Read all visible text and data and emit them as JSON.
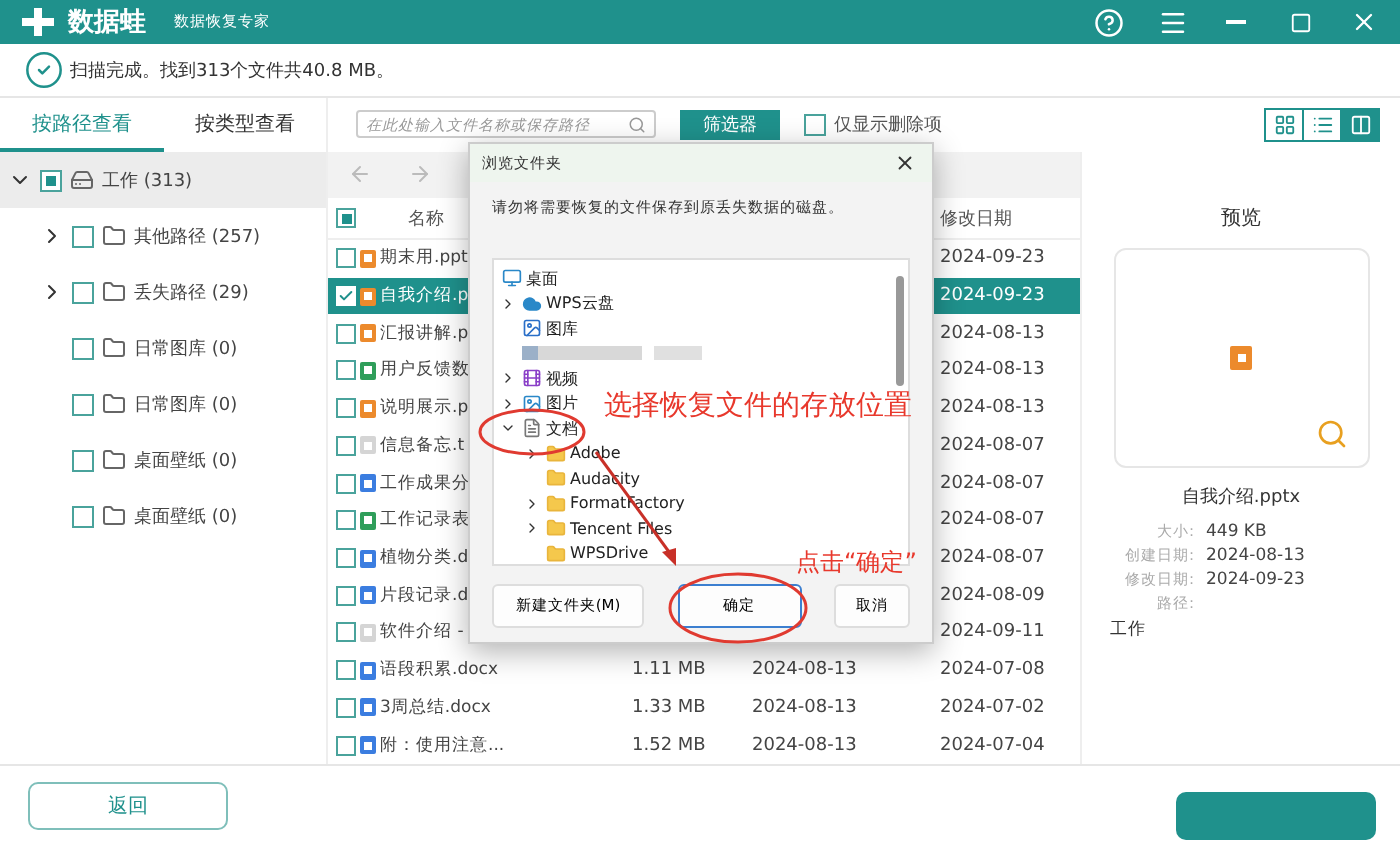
{
  "window": {
    "app_name": "数据蛙",
    "subtitle": "数据恢复专家"
  },
  "status": "扫描完成。找到313个文件共40.8 MB。",
  "view_tabs": [
    {
      "label": "按路径查看",
      "selected": true
    },
    {
      "label": "按类型查看",
      "selected": false
    }
  ],
  "search": {
    "placeholder": "在此处输入文件名称或保存路径"
  },
  "filter_button": "筛选器",
  "deleted_only": {
    "label": "仅显示删除项",
    "checked": false
  },
  "view_modes": [
    {
      "kind": "grid",
      "selected": false
    },
    {
      "kind": "list",
      "selected": false
    },
    {
      "kind": "detail",
      "selected": true
    }
  ],
  "tree": [
    {
      "label": "工作 (313)",
      "kind": "drive",
      "expandable": true,
      "expanded": true,
      "selected": true,
      "partial": true,
      "children": [
        {
          "label": "其他路径 (257)",
          "kind": "folder",
          "expandable": true,
          "expanded": false,
          "selected": false,
          "checked": false
        },
        {
          "label": "丢失路径 (29)",
          "kind": "folder",
          "expandable": true,
          "expanded": false,
          "selected": false,
          "checked": false
        },
        {
          "label": "日常图库 (0)",
          "kind": "folder",
          "expandable": false,
          "selected": false,
          "checked": false
        },
        {
          "label": "日常图库 (0)",
          "kind": "folder",
          "expandable": false,
          "selected": false,
          "checked": false
        },
        {
          "label": "桌面壁纸 (0)",
          "kind": "folder",
          "expandable": false,
          "selected": false,
          "checked": false
        },
        {
          "label": "桌面壁纸 (0)",
          "kind": "folder",
          "expandable": false,
          "selected": false,
          "checked": false
        }
      ]
    }
  ],
  "file_list": {
    "header": {
      "partial": true,
      "name": "名称",
      "modified": "修改日期"
    },
    "rows": [
      {
        "name": "期末用.ppt",
        "kind": "ppt",
        "checked": false,
        "selected": false,
        "modified": "2024-09-23"
      },
      {
        "name": "自我介绍.p",
        "kind": "ppt",
        "checked": true,
        "selected": true,
        "modified": "2024-09-23"
      },
      {
        "name": "汇报讲解.p",
        "kind": "ppt",
        "checked": false,
        "selected": false,
        "modified": "2024-08-13"
      },
      {
        "name": "用户反馈数",
        "kind": "xls",
        "checked": false,
        "selected": false,
        "modified": "2024-08-13"
      },
      {
        "name": "说明展示.p",
        "kind": "ppt",
        "checked": false,
        "selected": false,
        "modified": "2024-08-13"
      },
      {
        "name": "信息备忘.t",
        "kind": "txt",
        "checked": false,
        "selected": false,
        "modified": "2024-08-07"
      },
      {
        "name": "工作成果分",
        "kind": "doc",
        "checked": false,
        "selected": false,
        "modified": "2024-08-07"
      },
      {
        "name": "工作记录表",
        "kind": "xls",
        "checked": false,
        "selected": false,
        "modified": "2024-08-07"
      },
      {
        "name": "植物分类.d",
        "kind": "doc",
        "checked": false,
        "selected": false,
        "modified": "2024-08-07"
      },
      {
        "name": "片段记录.d",
        "kind": "doc",
        "checked": false,
        "selected": false,
        "modified": "2024-08-09"
      },
      {
        "name": "软件介绍 -",
        "kind": "txt",
        "checked": false,
        "selected": false,
        "modified": "2024-09-11"
      },
      {
        "name": "语段积累.docx",
        "kind": "doc",
        "checked": false,
        "selected": false,
        "size": "1.11 MB",
        "created": "2024-08-13",
        "modified": "2024-07-08"
      },
      {
        "name": "3周总结.docx",
        "kind": "doc",
        "checked": false,
        "selected": false,
        "size": "1.33 MB",
        "created": "2024-08-13",
        "modified": "2024-07-02"
      },
      {
        "name": "附：使用注意...",
        "kind": "doc",
        "checked": false,
        "selected": false,
        "size": "1.52 MB",
        "created": "2024-08-13",
        "modified": "2024-07-04"
      }
    ]
  },
  "preview": {
    "title": "预览",
    "kind": "ppt",
    "filename": "自我介绍.pptx",
    "details": [
      {
        "label": "大小:",
        "value": "449 KB"
      },
      {
        "label": "创建日期:",
        "value": "2024-08-13"
      },
      {
        "label": "修改日期:",
        "value": "2024-09-23"
      }
    ],
    "path_label": "路径:",
    "path": "工作"
  },
  "back_button": "返回",
  "dialog": {
    "title": "浏览文件夹",
    "message": "请勿将需要恢复的文件保存到原丢失数据的磁盘。",
    "folders": [
      {
        "label": "桌面",
        "kind": "desktop",
        "children": [
          {
            "label": "WPS云盘",
            "kind": "cloud",
            "expandable": true,
            "expanded": false
          },
          {
            "label": "图库",
            "kind": "gallery",
            "expandable": false
          },
          {
            "kind": "blurred",
            "expandable": false
          },
          {
            "label": "视频",
            "kind": "video",
            "expandable": true,
            "expanded": false
          },
          {
            "label": "图片",
            "kind": "picture",
            "expandable": true,
            "expanded": false
          },
          {
            "label": "文档",
            "kind": "documents",
            "expandable": true,
            "expanded": true,
            "children": [
              {
                "label": "Adobe",
                "kind": "folder",
                "expandable": true,
                "expanded": false
              },
              {
                "label": "Audacity",
                "kind": "folder",
                "expandable": false
              },
              {
                "label": "FormatFactory",
                "kind": "folder",
                "expandable": true,
                "expanded": false
              },
              {
                "label": "Tencent Files",
                "kind": "folder",
                "expandable": true,
                "expanded": false
              },
              {
                "label": "WPSDrive",
                "kind": "folder",
                "expandable": false
              }
            ]
          }
        ]
      }
    ],
    "buttons": [
      {
        "label": "新建文件夹(M)",
        "kind": "normal"
      },
      {
        "label": "确定",
        "kind": "default"
      },
      {
        "label": "取消",
        "kind": "normal"
      }
    ]
  },
  "annotations": [
    {
      "text": "选择恢复文件的存放位置"
    },
    {
      "text": "点击“确定”"
    }
  ]
}
